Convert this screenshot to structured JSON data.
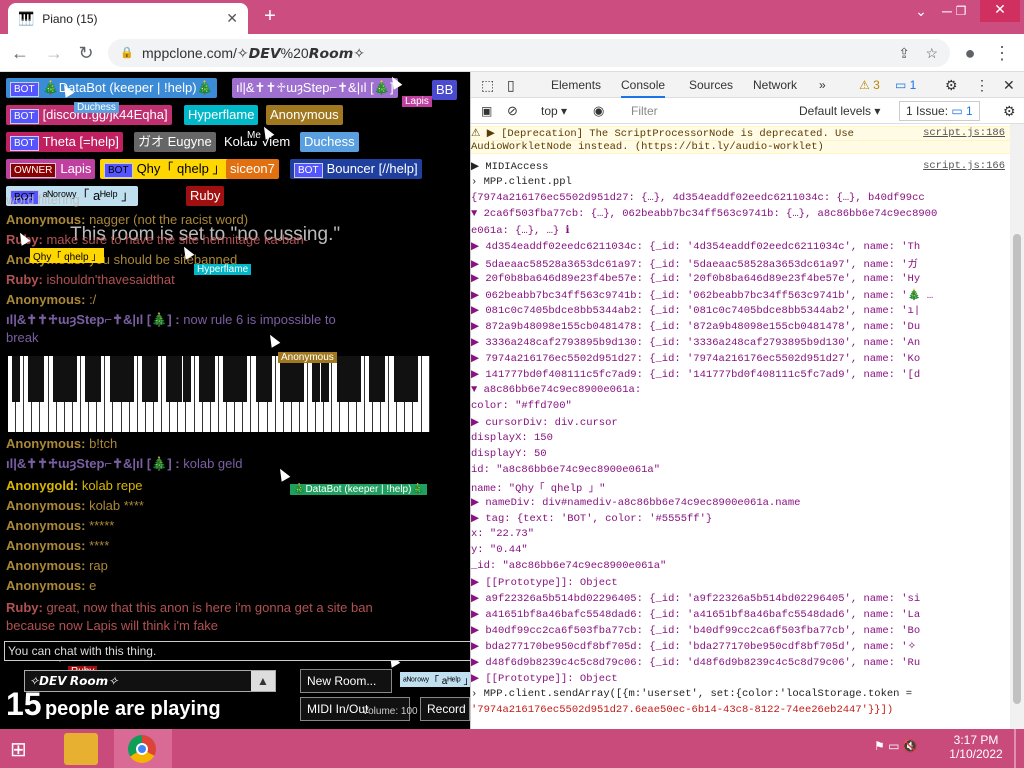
{
  "browser": {
    "tab_title": "Piano (15)",
    "url": "mppclone.com/✧𝘿𝙀𝙑%20𝙍𝙤𝙤𝙢✧"
  },
  "page": {
    "tags": [
      {
        "badge": "BOT",
        "label": "🎄DataBot (keeper | !help)🎄",
        "color": "#3b8bd6"
      },
      {
        "badge": "",
        "label": "ıl|&✝✝♱ɯȝStep⌐✝&|ıl [🎄]",
        "color": "#a070d0"
      },
      {
        "badge": "",
        "label": "BB",
        "color": "#4a4ad0"
      },
      {
        "badge": "BOT",
        "label": "[discord.gg/jk44Eqha]",
        "color": "#c03070"
      },
      {
        "badge": "",
        "label": "Hyperflame",
        "color": "#00b8c8"
      },
      {
        "badge": "",
        "label": "Anonymous",
        "color": "#a07820"
      },
      {
        "badge": "BOT",
        "label": "Theta [=help]",
        "color": "#c02060"
      },
      {
        "badge": "",
        "label": "ガオ Eugyne",
        "color": "#666666"
      },
      {
        "badge": "",
        "label": "Kolab Viem",
        "color": "#000000"
      },
      {
        "badge": "",
        "label": "Duchess",
        "color": "#5aa0e0"
      },
      {
        "badge": "OWNER",
        "label": "Lapis",
        "color": "#c040a0"
      },
      {
        "badge": "BOT",
        "label": "Qhy「 qhelp 」",
        "color": "#ffd700"
      },
      {
        "badge": "",
        "label": "siceon7",
        "color": "#e07010"
      },
      {
        "badge": "BOT",
        "label": "Bouncer [//help]",
        "color": "#2040a0"
      },
      {
        "badge": "BOT",
        "label": "ᵃᴺᵒʳᵒʷʸ「 aᴴᵉˡᵖ 」",
        "color": "#c0e0f0"
      },
      {
        "badge": "",
        "label": "Ruby",
        "color": "#a01010"
      }
    ],
    "notice": "This room is set to \"no cussing.\"",
    "chat": [
      {
        "name": "",
        "text": "word filtering",
        "color": "#bbbbbb"
      },
      {
        "name": "Anonymous:",
        "text": "nagger (not the racist word)",
        "color": "#c8a040"
      },
      {
        "name": "Ruby:",
        "text": "make sure to have the site hermitage ka-ban-",
        "color": "#d06060"
      },
      {
        "name": "Anonymous:",
        "text": "you should be sitebanned",
        "color": "#c8a040"
      },
      {
        "name": "Ruby:",
        "text": "ishouldn'thavesaidthat",
        "color": "#d06060"
      },
      {
        "name": "Anonymous:",
        "text": ":/",
        "color": "#c8a040"
      },
      {
        "name": "ıl|&✝✝♱ɯȝStep⌐✝&|ıl [🎄] :",
        "text": "now rule 6 is impossible to",
        "color": "#9070c0"
      },
      {
        "name": "",
        "text": "break",
        "color": "#9070c0"
      },
      {
        "name": "Anonymous:",
        "text": "b!tch",
        "color": "#c8a040"
      },
      {
        "name": "ıl|&✝✝♱ɯȝStep⌐✝&|ıl [🎄] :",
        "text": "kolab geld",
        "color": "#9070c0"
      },
      {
        "name": "Anonygold:",
        "text": "kolab repe",
        "color": "#ffd700"
      },
      {
        "name": "Anonymous:",
        "text": "kolab ****",
        "color": "#c8a040"
      },
      {
        "name": "Anonymous:",
        "text": "*****",
        "color": "#c8a040"
      },
      {
        "name": "Anonymous:",
        "text": "****",
        "color": "#c8a040"
      },
      {
        "name": "Anonymous:",
        "text": "rap",
        "color": "#c8a040"
      },
      {
        "name": "Anonymous:",
        "text": "e",
        "color": "#c8a040"
      },
      {
        "name": "Ruby:",
        "text": "great, now that this anon is here i'm gonna get a site ban",
        "color": "#d06060"
      },
      {
        "name": "",
        "text": "because now Lapis will think i'm fake",
        "color": "#d06060"
      }
    ],
    "cursor_labels": [
      {
        "label": "Duchess",
        "color": "#5aa0e0"
      },
      {
        "label": "Lapis",
        "color": "#c040a0"
      },
      {
        "label": "Me",
        "color": "#000000"
      },
      {
        "label": "Qhy「 qhelp 」",
        "color": "#ffd700"
      },
      {
        "label": "Hyperflame",
        "color": "#00b8c8"
      },
      {
        "label": "Anonymous",
        "color": "#a07820"
      },
      {
        "label": "🎄DataBot (keeper | !help)🎄",
        "color": "#20a060"
      },
      {
        "label": "Ruby",
        "color": "#a01010"
      },
      {
        "label": "ᵃᴺᵒʳᵒʷʸ「 aᴴᵉˡᵖ 」",
        "color": "#c0e0f0"
      }
    ],
    "chat_placeholder": "You can chat with this thing.",
    "room_name": "✧𝘿𝙀𝙑 𝙍𝙤𝙤𝙢✧",
    "new_room_btn": "New Room...",
    "midi_btn": "MIDI In/Out",
    "volume_label": "Volume: 100",
    "record_btn": "Record",
    "playing_count": "15",
    "playing_text": "people are playing"
  },
  "devtools": {
    "tabs": [
      "Elements",
      "Console",
      "Sources",
      "Network"
    ],
    "more": "»",
    "warn_count": "3",
    "msg_count": "1",
    "context": "top",
    "filter_placeholder": "Filter",
    "levels": "Default levels",
    "issues": "1 Issue:",
    "issues_count": "1"
  },
  "console_lines": [
    {
      "t": "warn",
      "text": "[Deprecation] The ScriptProcessorNode is deprecated. Use",
      "src": "script.js:186"
    },
    {
      "t": "warn2",
      "text": "AudioWorkletNode instead. (https://bit.ly/audio-worklet)"
    },
    {
      "t": "obj",
      "text": "▶ MIDIAccess",
      "src": "script.js:166"
    },
    {
      "t": "in",
      "text": "MPP.client.ppl"
    },
    {
      "t": "obj",
      "text": "  {7974a216176ec5502d951d27: {…}, 4d354eaddf02eedc6211034c: {…}, b40df99cc"
    },
    {
      "t": "obj",
      "text": "▼ 2ca6f503fba77cb: {…}, 062beabb7bc34ff563c9741b: {…}, a8c86bb6e74c9ec8900"
    },
    {
      "t": "obj",
      "text": "  e061a: {…}, …} ℹ"
    },
    {
      "t": "obj",
      "text": "  ▶ 4d354eaddf02eedc6211034c: {_id: '4d354eaddf02eedc6211034c', name: 'Th"
    },
    {
      "t": "obj",
      "text": "  ▶ 5daeaac58528a3653dc61a97: {_id: '5daeaac58528a3653dc61a97', name: 'ガ"
    },
    {
      "t": "obj",
      "text": "  ▶ 20f0b8ba646d89e23f4be57e: {_id: '20f0b8ba646d89e23f4be57e', name: 'Hy"
    },
    {
      "t": "obj",
      "text": "  ▶ 062beabb7bc34ff563c9741b: {_id: '062beabb7bc34ff563c9741b', name: '🎄 …"
    },
    {
      "t": "obj",
      "text": "  ▶ 081c0c7405bdce8bb5344ab2: {_id: '081c0c7405bdce8bb5344ab2', name: 'ı|"
    },
    {
      "t": "obj",
      "text": "  ▶ 872a9b48098e155cb0481478: {_id: '872a9b48098e155cb0481478', name: 'Du"
    },
    {
      "t": "obj",
      "text": "  ▶ 3336a248caf2793895b9d130: {_id: '3336a248caf2793895b9d130', name: 'An"
    },
    {
      "t": "obj",
      "text": "  ▶ 7974a216176ec5502d951d27: {_id: '7974a216176ec5502d951d27', name: 'Ko"
    },
    {
      "t": "obj",
      "text": "  ▶ 141777bd0f408111c5fc7ad9: {_id: '141777bd0f408111c5fc7ad9', name: '[d"
    },
    {
      "t": "obj",
      "text": "  ▼ a8c86bb6e74c9ec8900e061a:"
    },
    {
      "t": "obj",
      "text": "       color: \"#ffd700\""
    },
    {
      "t": "obj",
      "text": "     ▶ cursorDiv: div.cursor"
    },
    {
      "t": "obj",
      "text": "       displayX: 150"
    },
    {
      "t": "obj",
      "text": "       displayY: 50"
    },
    {
      "t": "obj",
      "text": "       id: \"a8c86bb6e74c9ec8900e061a\""
    },
    {
      "t": "obj",
      "text": "       name: \"Qhy「 qhelp 」\""
    },
    {
      "t": "obj",
      "text": "     ▶ nameDiv: div#namediv-a8c86bb6e74c9ec8900e061a.name"
    },
    {
      "t": "obj",
      "text": "     ▶ tag: {text: 'BOT', color: '#5555ff'}"
    },
    {
      "t": "obj",
      "text": "       x: \"22.73\""
    },
    {
      "t": "obj",
      "text": "       y: \"0.44\""
    },
    {
      "t": "obj",
      "text": "       _id: \"a8c86bb6e74c9ec8900e061a\""
    },
    {
      "t": "obj",
      "text": "     ▶ [[Prototype]]: Object"
    },
    {
      "t": "obj",
      "text": "  ▶ a9f22326a5b514bd02296405: {_id: 'a9f22326a5b514bd02296405', name: 'si"
    },
    {
      "t": "obj",
      "text": "  ▶ a41651bf8a46bafc5548dad6: {_id: 'a41651bf8a46bafc5548dad6', name: 'La"
    },
    {
      "t": "obj",
      "text": "  ▶ b40df99cc2ca6f503fba77cb: {_id: 'b40df99cc2ca6f503fba77cb', name: 'Bo"
    },
    {
      "t": "obj",
      "text": "  ▶ bda277170be950cdf8bf705d: {_id: 'bda277170be950cdf8bf705d', name: '✧"
    },
    {
      "t": "obj",
      "text": "  ▶ d48f6d9b8239c4c5c8d79c06: {_id: 'd48f6d9b8239c4c5c8d79c06', name: 'Ru"
    },
    {
      "t": "obj",
      "text": "  ▶ [[Prototype]]: Object"
    },
    {
      "t": "in",
      "text": "MPP.client.sendArray([{m:'userset', set:{color:'localStorage.token ="
    },
    {
      "t": "in2",
      "text": "'7974a216176ec5502d951d27.6eae50ec-6b14-43c8-8122-74ee26eb2447'}}])"
    }
  ],
  "taskbar": {
    "time": "3:17 PM",
    "date": "1/10/2022"
  }
}
